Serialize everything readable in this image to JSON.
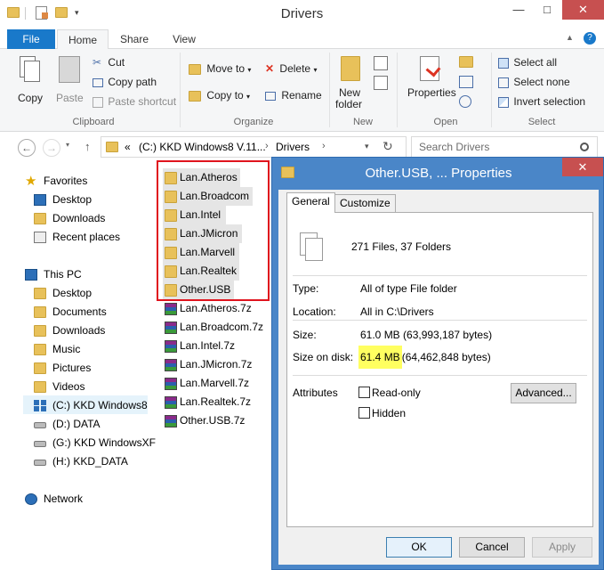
{
  "window": {
    "title": "Drivers"
  },
  "ribbon": {
    "tabs": {
      "file": "File",
      "home": "Home",
      "share": "Share",
      "view": "View"
    },
    "clipboard": {
      "copy": "Copy",
      "paste": "Paste",
      "cut": "Cut",
      "copy_path": "Copy path",
      "paste_shortcut": "Paste shortcut",
      "label": "Clipboard"
    },
    "organize": {
      "move_to": "Move to",
      "copy_to": "Copy to",
      "delete": "Delete",
      "rename": "Rename",
      "label": "Organize"
    },
    "new": {
      "new_folder_1": "New",
      "new_folder_2": "folder",
      "label": "New"
    },
    "open": {
      "properties": "Properties",
      "label": "Open"
    },
    "select": {
      "select_all": "Select all",
      "select_none": "Select none",
      "invert": "Invert selection",
      "label": "Select"
    }
  },
  "address": {
    "prefix": "«",
    "segment1": "(C:) KKD Windows8 V.11...",
    "segment2": "Drivers",
    "search_placeholder": "Search Drivers"
  },
  "nav": {
    "favorites": "Favorites",
    "desktop": "Desktop",
    "downloads": "Downloads",
    "recent": "Recent places",
    "this_pc": "This PC",
    "pc_desktop": "Desktop",
    "documents": "Documents",
    "pc_downloads": "Downloads",
    "music": "Music",
    "pictures": "Pictures",
    "videos": "Videos",
    "drive_c": "(C:) KKD Windows8",
    "drive_d": "(D:) DATA",
    "drive_g": "(G:) KKD WindowsXF",
    "drive_h": "(H:) KKD_DATA",
    "network": "Network"
  },
  "files": {
    "folders": [
      "Lan.Atheros",
      "Lan.Broadcom",
      "Lan.Intel",
      "Lan.JMicron",
      "Lan.Marvell",
      "Lan.Realtek",
      "Other.USB"
    ],
    "archives": [
      "Lan.Atheros.7z",
      "Lan.Broadcom.7z",
      "Lan.Intel.7z",
      "Lan.JMicron.7z",
      "Lan.Marvell.7z",
      "Lan.Realtek.7z",
      "Other.USB.7z"
    ]
  },
  "dialog": {
    "title": "Other.USB, ... Properties",
    "tab_general": "General",
    "tab_customize": "Customize",
    "summary": "271 Files, 37 Folders",
    "type_label": "Type:",
    "type_value": "All of type File folder",
    "location_label": "Location:",
    "location_value": "All in C:\\Drivers",
    "size_label": "Size:",
    "size_value": "61.0 MB (63,993,187 bytes)",
    "size_on_disk_label": "Size on disk:",
    "size_on_disk_highlight": "61.4 MB",
    "size_on_disk_rest": "(64,462,848 bytes)",
    "attributes_label": "Attributes",
    "readonly": "Read-only",
    "hidden": "Hidden",
    "advanced": "Advanced...",
    "ok": "OK",
    "cancel": "Cancel",
    "apply": "Apply"
  }
}
